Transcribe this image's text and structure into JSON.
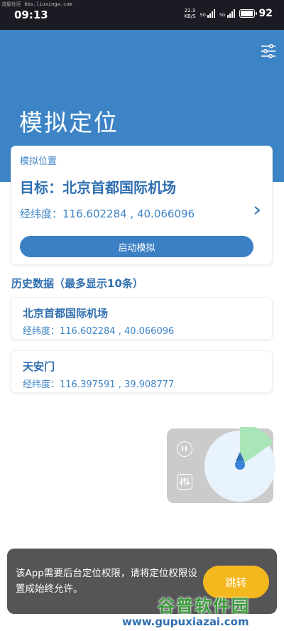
{
  "status_bar": {
    "time": "09:13",
    "watermark": "流星社区 bbs.liuxingw.com",
    "net_speed_value": "22.3",
    "net_speed_unit": "KB/S",
    "signal_1_tag": "5G",
    "signal_2_tag": "5G",
    "battery": "92"
  },
  "header": {
    "title": "模拟定位",
    "settings_icon": "sliders-icon"
  },
  "target": {
    "label": "模拟位置",
    "title": "目标：北京首都国际机场",
    "coords": "经纬度：116.602284 , 40.066096",
    "start_button": "启动模拟"
  },
  "history": {
    "title": "历史数据（最多显示10条）",
    "items": [
      {
        "name": "北京首都国际机场",
        "coords": "经纬度：116.602284 , 40.066096"
      },
      {
        "name": "天安门",
        "coords": "经纬度：116.397591 , 39.908777"
      }
    ]
  },
  "toast": {
    "message": "该App需要后台定位权限，请将定位权限设置成始终允许。",
    "button": "跳转"
  },
  "watermark": {
    "logo": "谷普软件园",
    "url": "www.gupuxiazai.com"
  },
  "colors": {
    "primary": "#3d84c6",
    "accent": "#f4b81f",
    "toast_bg": "#555558"
  }
}
